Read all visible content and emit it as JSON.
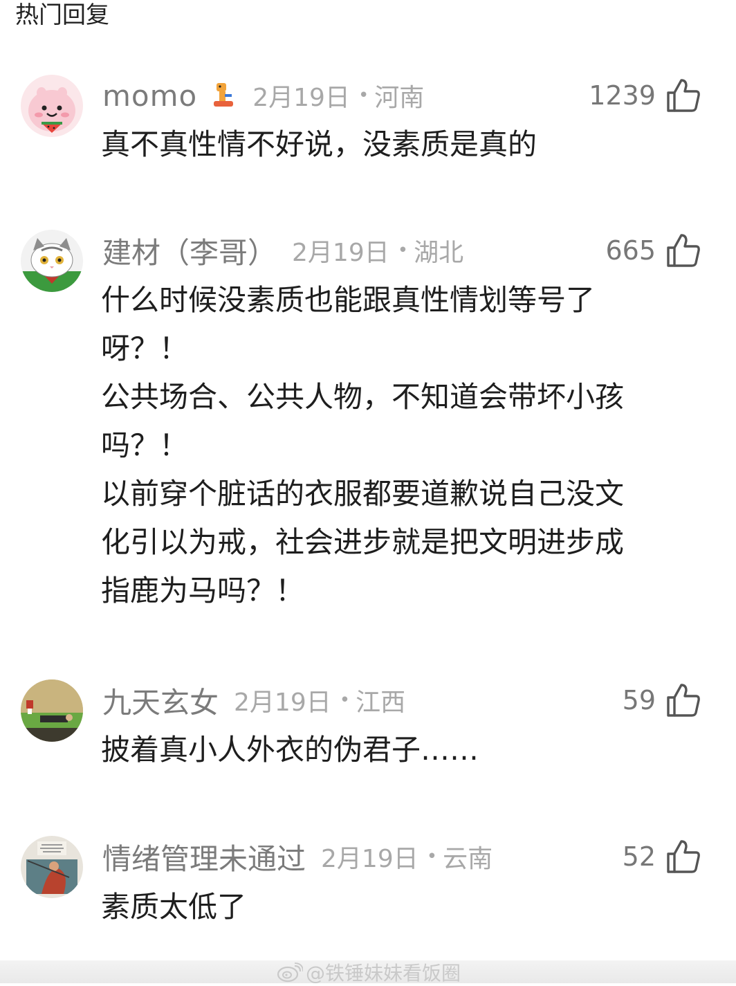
{
  "section_title": "热门回复",
  "colors": {
    "meta_gray": "#a8a8a8",
    "name_gray": "#7b7b7b",
    "text": "#1e1e1e",
    "icon": "#555555"
  },
  "comments": [
    {
      "username": "momo",
      "avatar_icon": "pink-cartoon-avatar-icon",
      "badge_icon": "cartoon-badge-icon",
      "date": "2月19日",
      "separator": "•",
      "location": "河南",
      "likes": "1239",
      "text": "真不真性情不好说，没素质是真的"
    },
    {
      "username": "建材（李哥）",
      "avatar_icon": "cat-avatar-icon",
      "date": "2月19日",
      "separator": "•",
      "location": "湖北",
      "likes": "665",
      "text": "什么时候没素质也能跟真性情划等号了\n呀？！\n公共场合、公共人物，不知道会带坏小孩\n吗？！\n以前穿个脏话的衣服都要道歉说自己没文\n化引以为戒，社会进步就是把文明进步成\n指鹿为马吗？！"
    },
    {
      "username": "九天玄女",
      "avatar_icon": "landscape-avatar-icon",
      "date": "2月19日",
      "separator": "•",
      "location": "江西",
      "likes": "59",
      "text": "披着真小人外衣的伪君子……"
    },
    {
      "username": "情绪管理未通过",
      "avatar_icon": "painting-avatar-icon",
      "date": "2月19日",
      "separator": "•",
      "location": "云南",
      "likes": "52",
      "text": "素质太低了"
    }
  ],
  "watermark": {
    "icon": "weibo-logo-icon",
    "text": "@铁锤妹妹看饭圈"
  }
}
